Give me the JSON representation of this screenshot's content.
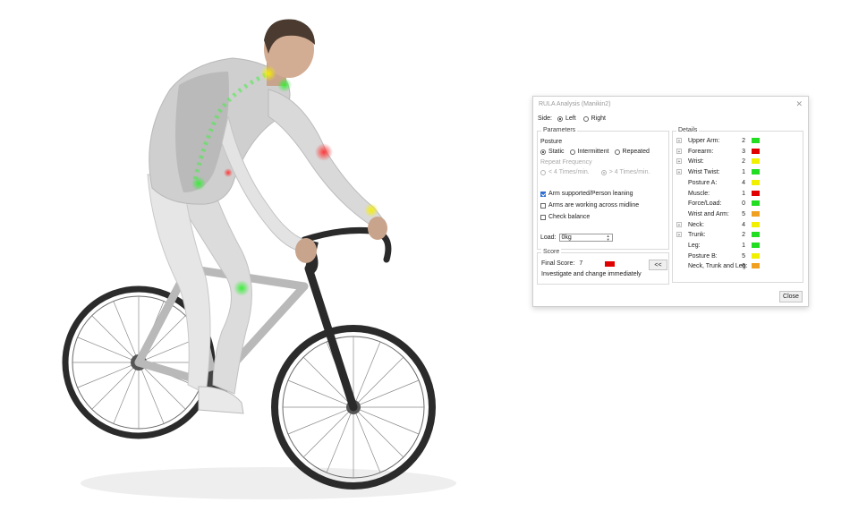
{
  "dialog": {
    "title": "RULA Analysis (Manikin2)",
    "close_glyph": "✕",
    "side": {
      "label": "Side:",
      "left": "Left",
      "right": "Right",
      "selected": "left"
    },
    "parameters": {
      "legend": "Parameters",
      "posture_label": "Posture",
      "posture_options": [
        "Static",
        "Intermittent",
        "Repeated"
      ],
      "repeat_label": "Repeat Frequency",
      "repeat_options": [
        "< 4 Times/min.",
        "> 4 Times/min."
      ],
      "checks": [
        {
          "label": "Arm supported/Person leaning",
          "checked": true
        },
        {
          "label": "Arms are working across midline",
          "checked": false
        },
        {
          "label": "Check balance",
          "checked": false
        }
      ],
      "load_label": "Load:",
      "load_value": "0kg"
    },
    "score": {
      "legend": "Score",
      "final_label": "Final Score:",
      "final_value": "7",
      "final_color": "#e00000",
      "collapse_button": "<<",
      "message": "Investigate and change immediately"
    },
    "details": {
      "legend": "Details",
      "expand_glyph": "+",
      "rows": [
        {
          "label": "Upper Arm:",
          "value": "2",
          "color": "#22dd22",
          "expand": true
        },
        {
          "label": "Forearm:",
          "value": "3",
          "color": "#e00000",
          "expand": true
        },
        {
          "label": "Wrist:",
          "value": "2",
          "color": "#f0f000",
          "expand": true
        },
        {
          "label": "Wrist Twist:",
          "value": "1",
          "color": "#22dd22",
          "expand": true
        },
        {
          "label": "Posture A:",
          "value": "4",
          "color": "#f0f000",
          "expand": false
        },
        {
          "label": "Muscle:",
          "value": "1",
          "color": "#e00000",
          "expand": false
        },
        {
          "label": "Force/Load:",
          "value": "0",
          "color": "#22dd22",
          "expand": false
        },
        {
          "label": "Wrist and Arm:",
          "value": "5",
          "color": "#f0a020",
          "expand": false
        },
        {
          "label": "Neck:",
          "value": "4",
          "color": "#f0f000",
          "expand": true
        },
        {
          "label": "Trunk:",
          "value": "2",
          "color": "#22dd22",
          "expand": true
        },
        {
          "label": "Leg:",
          "value": "1",
          "color": "#22dd22",
          "expand": false
        },
        {
          "label": "Posture B:",
          "value": "5",
          "color": "#f0f000",
          "expand": false
        },
        {
          "label": "Neck, Trunk and Leg:",
          "value": "6",
          "color": "#f0a020",
          "expand": false
        }
      ]
    },
    "close_button": "Close"
  }
}
